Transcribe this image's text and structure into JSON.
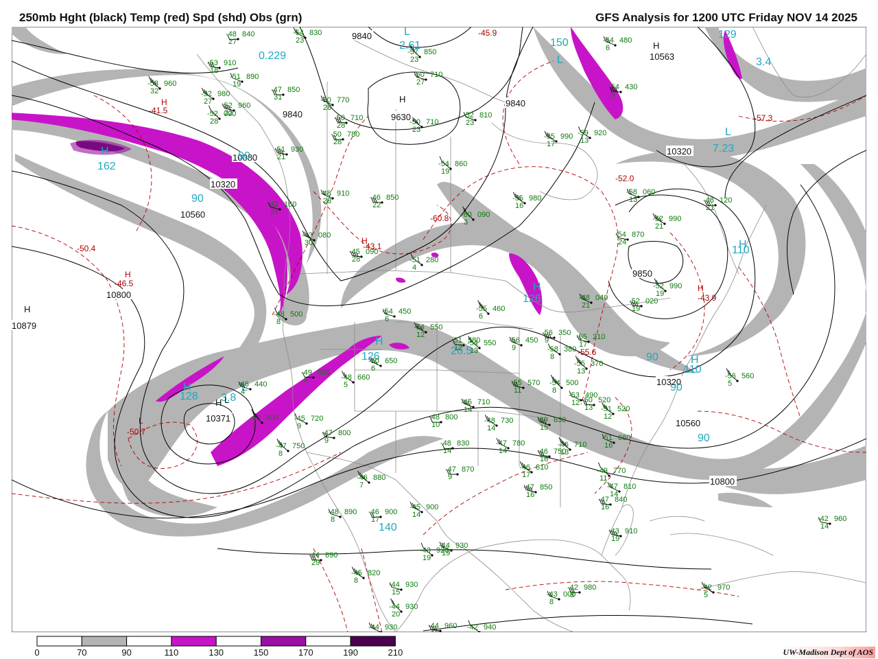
{
  "header": {
    "title_left": "250mb Hght (black) Temp (red) Spd (shd) Obs (grn)",
    "title_right": "GFS Analysis for 1200 UTC Friday  NOV 14 2025"
  },
  "footer": {
    "credit": "UW-Madison   Dept of AOS"
  },
  "colors": {
    "height": "#000000",
    "temperature": "#b00000",
    "observations": "#0a7a0a",
    "speed_labels": "#1ea9bf",
    "spd_70_90": "#b4b4b4",
    "spd_110_130": "#c814c8",
    "spd_130_150": "#9a0fa4",
    "spd_150_170": "#7a0a80",
    "spd_190_210": "#4a004e"
  },
  "legend": {
    "ticks": [
      "0",
      "70",
      "90",
      "110",
      "130",
      "150",
      "170",
      "190",
      "210"
    ],
    "fills": [
      "#ffffff",
      "#b4b4b4",
      "#ffffff",
      "#c814c8",
      "#ffffff",
      "#9a0fa4",
      "#ffffff",
      "#4a004e"
    ]
  },
  "height_labels": [
    "9840",
    "9840",
    "9840",
    "9630",
    "10080",
    "10320",
    "10560",
    "10800",
    "10879",
    "10371",
    "10320",
    "10560",
    "10800",
    "10320",
    "10563",
    "9850"
  ],
  "centers": [
    {
      "label": "H",
      "kind": "hgt"
    },
    {
      "label": "H",
      "kind": "hgt"
    },
    {
      "label": "H",
      "kind": "hgt"
    },
    {
      "label": "L",
      "kind": "hgt"
    },
    {
      "label": "H",
      "kind": "hgt"
    },
    {
      "label": "H",
      "kind": "spd"
    },
    {
      "label": "H",
      "kind": "spd"
    },
    {
      "label": "L",
      "kind": "spd"
    },
    {
      "label": "L",
      "kind": "spd"
    },
    {
      "label": "H",
      "kind": "spd"
    },
    {
      "label": "H",
      "kind": "tmp"
    },
    {
      "label": "H",
      "kind": "tmp"
    },
    {
      "label": "H",
      "kind": "tmp"
    },
    {
      "label": "L",
      "kind": "tmp"
    },
    {
      "label": "H",
      "kind": "tmp"
    },
    {
      "label": "L",
      "kind": "spd"
    },
    {
      "label": "H",
      "kind": "spd"
    },
    {
      "label": "H",
      "kind": "spd"
    },
    {
      "label": "L",
      "kind": "spd"
    },
    {
      "label": "H",
      "kind": "spd"
    }
  ],
  "speed_labels": [
    "0.229",
    "2.61",
    "150",
    "3.4",
    "129",
    "162",
    "90",
    "90",
    "128",
    "3.8",
    "126",
    "126",
    "26.5",
    "140",
    "90",
    "90",
    "90",
    "110",
    "7.23",
    "110"
  ],
  "temp_labels": [
    "-41.5",
    "-50.4",
    "-46.5",
    "-50.7",
    "-43.1",
    "-60.8",
    "-52.0",
    "-57.3",
    "-43.9",
    "-55.6",
    "-45.9"
  ],
  "obs": [
    {
      "t": "-48",
      "h": "840",
      "d": "27"
    },
    {
      "t": "-54",
      "h": "830",
      "d": "23"
    },
    {
      "t": "-53",
      "h": "910",
      "d": "18"
    },
    {
      "t": "-53",
      "h": "960",
      "d": "32"
    },
    {
      "t": "-51",
      "h": "890",
      "d": "19"
    },
    {
      "t": "-47",
      "h": "850",
      "d": "31"
    },
    {
      "t": "-52",
      "h": "980",
      "d": "27"
    },
    {
      "t": "-52",
      "h": "960",
      "d": "22"
    },
    {
      "t": "-52",
      "h": "000",
      "d": "28"
    },
    {
      "t": "-50",
      "h": "770",
      "d": "28"
    },
    {
      "t": "-50",
      "h": "710",
      "d": "28"
    },
    {
      "t": "-50",
      "h": "710",
      "d": "23"
    },
    {
      "t": "-52",
      "h": "810",
      "d": "23"
    },
    {
      "t": "-50",
      "h": "780",
      "d": "28"
    },
    {
      "t": "-55",
      "h": "990",
      "d": "17"
    },
    {
      "t": "-51",
      "h": "930",
      "d": "21"
    },
    {
      "t": "-54",
      "h": "860",
      "d": "19"
    },
    {
      "t": "-48",
      "h": "910",
      "d": "28"
    },
    {
      "t": "-46",
      "h": "850",
      "d": "22"
    },
    {
      "t": "-55",
      "h": "980",
      "d": "16"
    },
    {
      "t": "-42",
      "h": "160",
      "d": "24"
    },
    {
      "t": "-60",
      "h": "090",
      "d": "3"
    },
    {
      "t": "-43",
      "h": "080",
      "d": "30"
    },
    {
      "t": "-45",
      "h": "090",
      "d": "28"
    },
    {
      "t": "-51",
      "h": "280",
      "d": "4"
    },
    {
      "t": "-58",
      "h": "060",
      "d": "13"
    },
    {
      "t": "-48",
      "h": "120",
      "d": "21"
    },
    {
      "t": "-52",
      "h": "990",
      "d": "21"
    },
    {
      "t": "-54",
      "h": "870",
      "d": "24"
    },
    {
      "t": "-52",
      "h": "990",
      "d": "19"
    },
    {
      "t": "-48",
      "h": "040",
      "d": "21"
    },
    {
      "t": "-52",
      "h": "020",
      "d": "19"
    },
    {
      "t": "-48",
      "h": "500",
      "d": "8"
    },
    {
      "t": "-54",
      "h": "450",
      "d": "6"
    },
    {
      "t": "-55",
      "h": "460",
      "d": "6"
    },
    {
      "t": "-54",
      "h": "550",
      "d": "12"
    },
    {
      "t": "-51",
      "h": "580",
      "d": "12"
    },
    {
      "t": "-54",
      "h": "550",
      "d": "13"
    },
    {
      "t": "-56",
      "h": "450",
      "d": "9"
    },
    {
      "t": "-56",
      "h": "350",
      "d": "9"
    },
    {
      "t": "-58",
      "h": "380",
      "d": "8"
    },
    {
      "t": "-55",
      "h": "210",
      "d": "17"
    },
    {
      "t": "-55",
      "h": "370",
      "d": "13"
    },
    {
      "t": "-50",
      "h": "650",
      "d": "6"
    },
    {
      "t": "-49",
      "h": "550",
      "d": "6"
    },
    {
      "t": "-48",
      "h": "660",
      "d": "5"
    },
    {
      "t": "-46",
      "h": "440",
      "d": "4"
    },
    {
      "t": "-49",
      "h": "600",
      "d": "9"
    },
    {
      "t": "-45",
      "h": "720",
      "d": "9"
    },
    {
      "t": "-47",
      "h": "800",
      "d": "9"
    },
    {
      "t": "-47",
      "h": "750",
      "d": "8"
    },
    {
      "t": "-45",
      "h": "710",
      "d": "14"
    },
    {
      "t": "-48",
      "h": "800",
      "d": "10"
    },
    {
      "t": "-48",
      "h": "730",
      "d": "14"
    },
    {
      "t": "-55",
      "h": "570",
      "d": "11"
    },
    {
      "t": "-54",
      "h": "500",
      "d": "8"
    },
    {
      "t": "-53",
      "h": "490",
      "d": "12"
    },
    {
      "t": "-50",
      "h": "520",
      "d": "13"
    },
    {
      "t": "-51",
      "h": "520",
      "d": "12"
    },
    {
      "t": "-49",
      "h": "630",
      "d": "15"
    },
    {
      "t": "-48",
      "h": "830",
      "d": "14"
    },
    {
      "t": "-47",
      "h": "780",
      "d": "14"
    },
    {
      "t": "-46",
      "h": "750",
      "d": "16"
    },
    {
      "t": "-46",
      "h": "710",
      "d": "13"
    },
    {
      "t": "-51",
      "h": "660",
      "d": "16"
    },
    {
      "t": "-47",
      "h": "870",
      "d": "9"
    },
    {
      "t": "-46",
      "h": "810",
      "d": "17"
    },
    {
      "t": "-47",
      "h": "850",
      "d": "16"
    },
    {
      "t": "-49",
      "h": "770",
      "d": "11"
    },
    {
      "t": "-47",
      "h": "810",
      "d": "14"
    },
    {
      "t": "-47",
      "h": "840",
      "d": "16"
    },
    {
      "t": "-46",
      "h": "880",
      "d": "7"
    },
    {
      "t": "-48",
      "h": "890",
      "d": "8"
    },
    {
      "t": "-46",
      "h": "900",
      "d": "17"
    },
    {
      "t": "-45",
      "h": "900",
      "d": "14"
    },
    {
      "t": "-43",
      "h": "910",
      "d": "19"
    },
    {
      "t": "-43",
      "h": "920",
      "d": "19"
    },
    {
      "t": "-44",
      "h": "930",
      "d": "19"
    },
    {
      "t": "-44",
      "h": "890",
      "d": "29"
    },
    {
      "t": "-45",
      "h": "820",
      "d": "8"
    },
    {
      "t": "-44",
      "h": "930",
      "d": "15"
    },
    {
      "t": "-44",
      "h": "930",
      "d": "20"
    },
    {
      "t": "-44",
      "h": "930",
      "d": "23"
    },
    {
      "t": "-44",
      "h": "960",
      "d": "18"
    },
    {
      "t": "-42",
      "h": "940",
      "d": "18"
    },
    {
      "t": "-43",
      "h": "000",
      "d": "8"
    },
    {
      "t": "-42",
      "h": "980",
      "d": "8"
    },
    {
      "t": "-42",
      "h": "970",
      "d": "5"
    },
    {
      "t": "-42",
      "h": "960",
      "d": "14"
    },
    {
      "t": "-56",
      "h": "560",
      "d": "5"
    },
    {
      "t": "-54",
      "h": "480",
      "d": "6"
    },
    {
      "t": "-54",
      "h": "430",
      "d": "5"
    },
    {
      "t": "-59",
      "h": "920",
      "d": "13"
    },
    {
      "t": "-50",
      "h": "710",
      "d": "27"
    },
    {
      "t": "-57",
      "h": "850",
      "d": "23"
    }
  ]
}
